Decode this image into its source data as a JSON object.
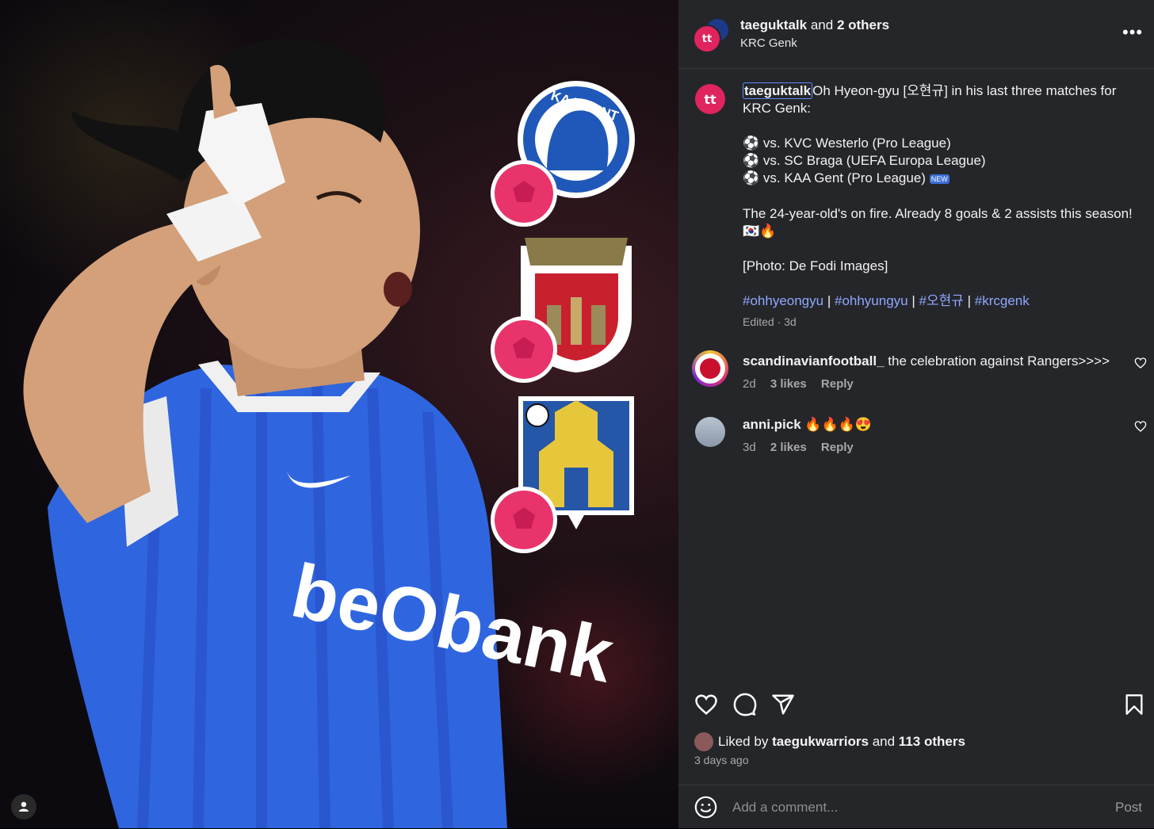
{
  "header": {
    "author": "taeguktalk",
    "others_joiner": "and",
    "others": "2 others",
    "location": "KRC Genk"
  },
  "caption": {
    "username": "taeguktalk",
    "intro": "Oh Hyeon-gyu [오현규] in his last three matches for KRC Genk:",
    "matches": [
      "vs. KVC Westerlo (Pro League)",
      "vs. SC Braga (UEFA Europa League)",
      "vs. KAA Gent (Pro League)"
    ],
    "new_badge": "NEW",
    "stats_line": "The 24-year-old's on fire. Already 8 goals & 2 assists this season! 🇰🇷🔥",
    "photo_credit": "[Photo: De Fodi Images]",
    "hashtags": [
      "#ohhyeongyu",
      "#ohhyungyu",
      "#오현규",
      "#krcgenk"
    ],
    "separator": "|",
    "edited": "Edited · 3d"
  },
  "photo": {
    "badges": [
      "KAA GENT",
      "SPORTING BRAGA",
      "KVC WESTERLO"
    ],
    "sponsor": "beObank"
  },
  "comments": [
    {
      "username": "scandinavianfootball_",
      "text": "the celebration against Rangers>>>>",
      "age": "2d",
      "likes": "3 likes",
      "reply": "Reply"
    },
    {
      "username": "anni.pick",
      "text": "🔥🔥🔥😍",
      "age": "3d",
      "likes": "2 likes",
      "reply": "Reply"
    }
  ],
  "likes": {
    "prefix": "Liked by",
    "user": "taegukwarriors",
    "joiner": "and",
    "others": "113 others",
    "time": "3 days ago"
  },
  "composer": {
    "placeholder": "Add a comment...",
    "post": "Post"
  },
  "colors": {
    "panel_bg": "#25262a",
    "link": "#8ea8ff",
    "genk_blue": "#2f66e0",
    "ball_pink": "#e8346b"
  }
}
